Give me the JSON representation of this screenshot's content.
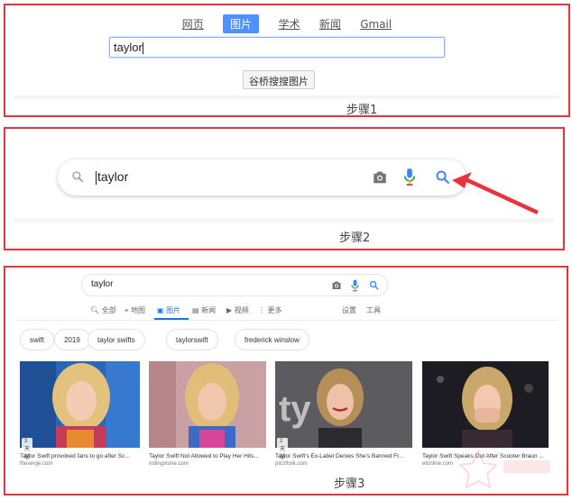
{
  "step1": {
    "tabs": [
      "网页",
      "图片",
      "学术",
      "新闻",
      "Gmail"
    ],
    "active_tab": 1,
    "query": "taylor",
    "button_label": "谷桥搜搜图片",
    "step_label": "步骤1"
  },
  "step2": {
    "query": "taylor",
    "step_label": "步骤2",
    "icons": [
      "search-icon",
      "camera-icon",
      "microphone-icon",
      "search-icon"
    ]
  },
  "step3": {
    "query": "taylor",
    "tabs": [
      "全部",
      "地图",
      "图片",
      "新闻",
      "视频",
      "更多"
    ],
    "active_tab": 2,
    "settings_label": "设置",
    "tools_label": "工具",
    "chips": [
      "swift",
      "2019",
      "taylor swifts",
      "taylorswift",
      "frederick winslow"
    ],
    "results": [
      {
        "caption": "Taylor Swift provoked fans to go after Sc...",
        "source": "theverge.com",
        "badge": "3 天前"
      },
      {
        "caption": "Taylor Swift Not Allowed to Play Her Hits...",
        "source": "rollingstone.com",
        "badge": ""
      },
      {
        "caption": "Taylor Swift's Ex-Label Denies She's Banned Fr...",
        "source": "pitchfork.com",
        "badge": "2 天前"
      },
      {
        "caption": "Taylor Swift Speaks Out After Scooter Braun ...",
        "source": "etonline.com",
        "badge": ""
      }
    ],
    "step_label": "步骤3"
  },
  "colors": {
    "frame": "#e8323c",
    "google_blue": "#4285f4",
    "active_blue": "#1a73e8"
  }
}
